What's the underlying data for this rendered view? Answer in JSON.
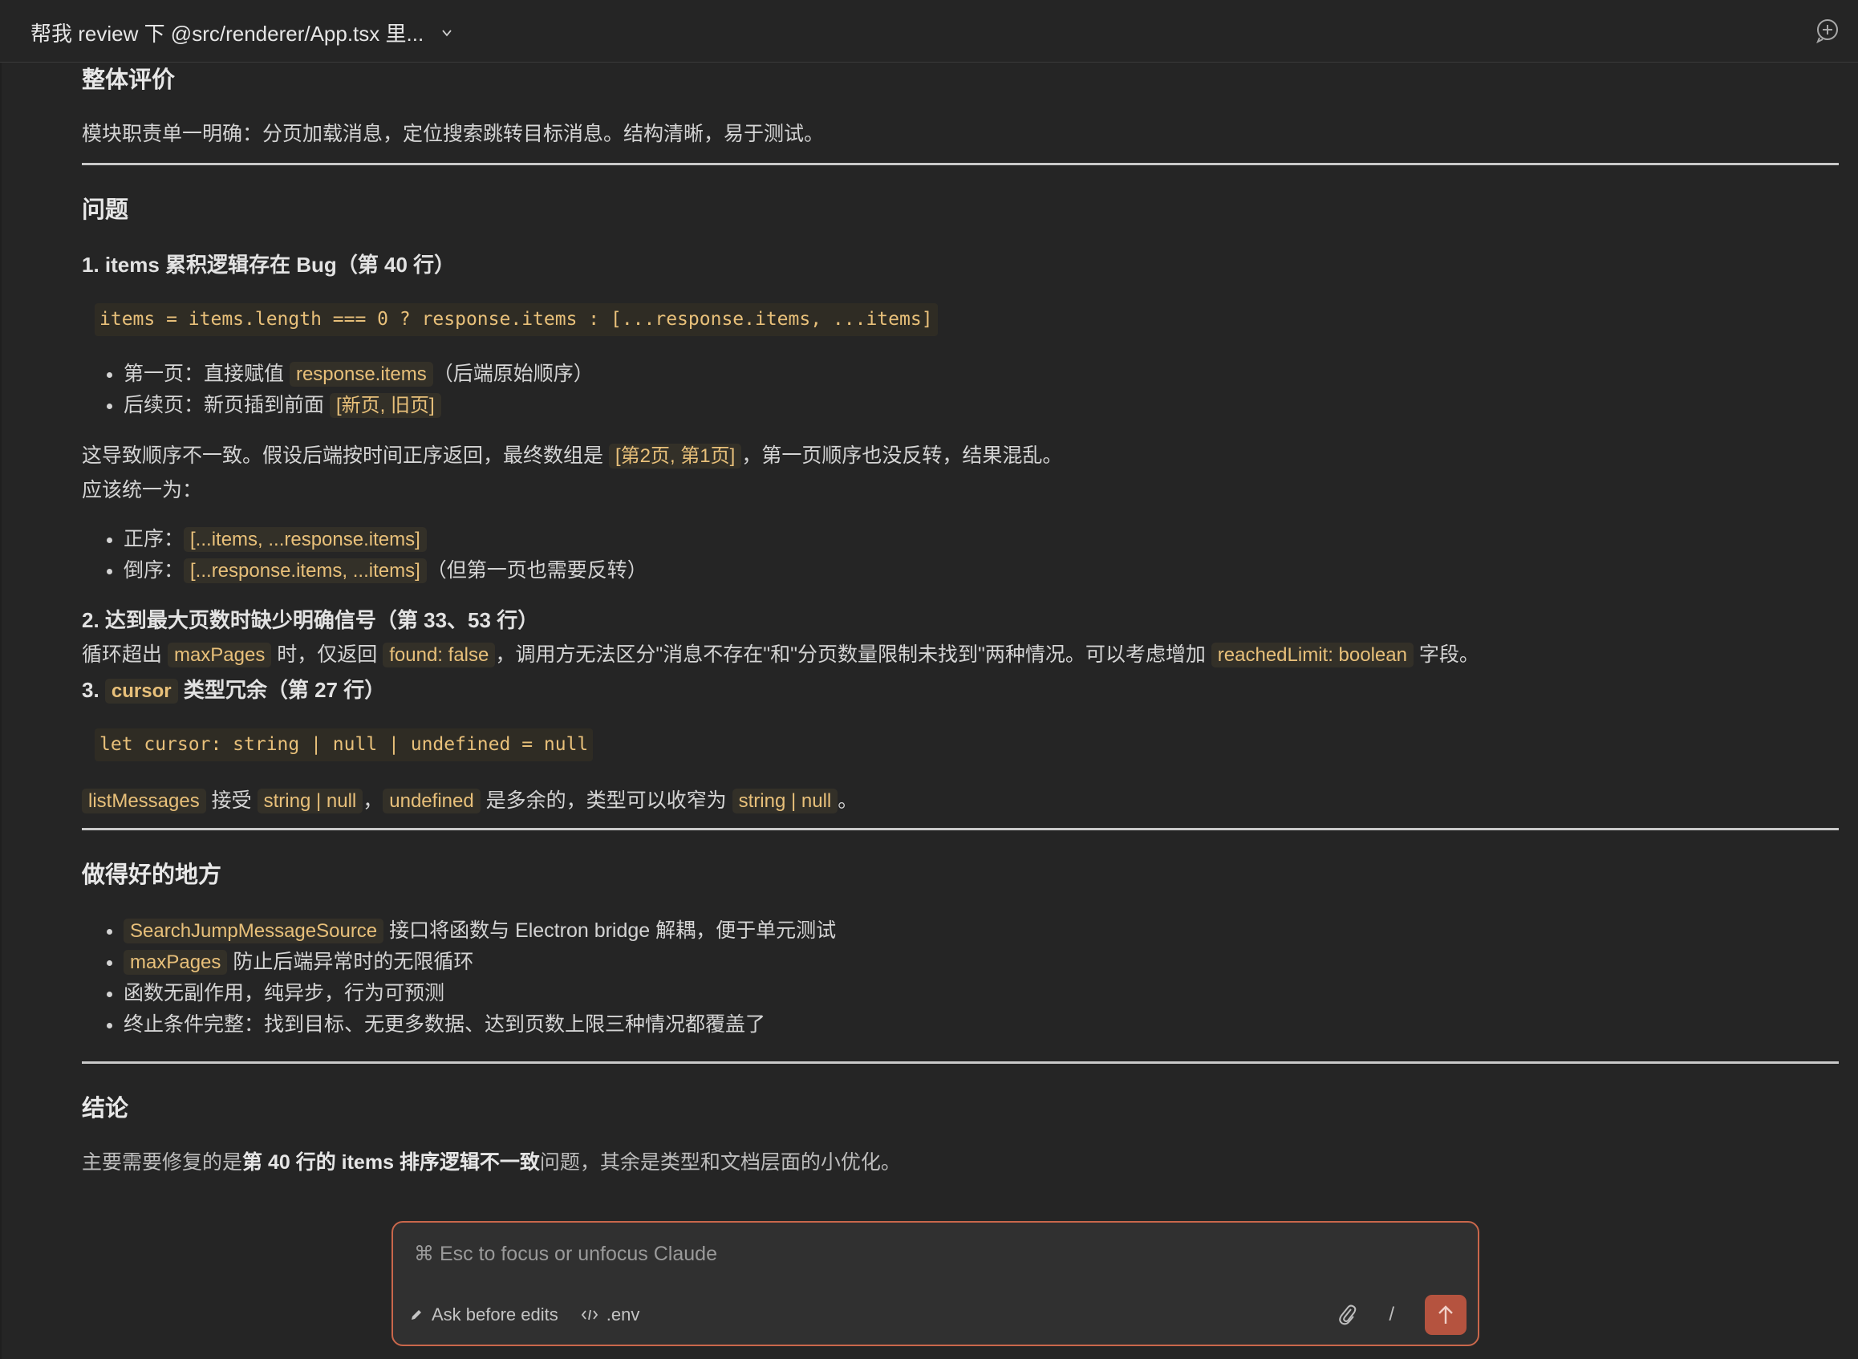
{
  "header": {
    "title": "帮我 review 下 @src/renderer/App.tsx 里..."
  },
  "review": {
    "overall": {
      "heading": "整体评价",
      "text": "模块职责单一明确：分页加载消息，定位搜索跳转目标消息。结构清晰，易于测试。"
    },
    "issues": {
      "heading": "问题",
      "issue1": {
        "title": "1. items 累积逻辑存在 Bug（第 40 行）",
        "code": "items = items.length === 0 ? response.items : [...response.items, ...items]",
        "bullets": [
          {
            "prefix": "第一页：直接赋值 ",
            "code": "response.items",
            "suffix": "（后端原始顺序）"
          },
          {
            "prefix": "后续页：新页插到前面 ",
            "code": "[新页, 旧页]",
            "suffix": ""
          }
        ],
        "para_prefix": "这导致顺序不一致。假设后端按时间正序返回，最终数组是 ",
        "para_code": "[第2页, 第1页]",
        "para_suffix": "，第一页顺序也没反转，结果混乱。",
        "para2": "应该统一为：",
        "fix_bullets": [
          {
            "prefix": "正序：",
            "code": "[...items, ...response.items]",
            "suffix": ""
          },
          {
            "prefix": "倒序：",
            "code": "[...response.items, ...items]",
            "suffix": "（但第一页也需要反转）"
          }
        ]
      },
      "issue2": {
        "title": "2. 达到最大页数时缺少明确信号（第 33、53 行）",
        "t1": "循环超出 ",
        "c1": "maxPages",
        "t2": " 时，仅返回 ",
        "c2": "found: false",
        "t3": "，调用方无法区分\"消息不存在\"和\"分页数量限制未找到\"两种情况。可以考虑增加 ",
        "c3": "reachedLimit: boolean",
        "t4": " 字段。"
      },
      "issue3": {
        "title_prefix": "3. ",
        "title_code": "cursor",
        "title_suffix": " 类型冗余（第 27 行）",
        "code": "let cursor: string | null | undefined = null",
        "c1": "listMessages",
        "t1": " 接受 ",
        "c2": "string | null",
        "t2": "，",
        "c3": "undefined",
        "t3": " 是多余的，类型可以收窄为 ",
        "c4": "string | null",
        "t4": "。"
      }
    },
    "good": {
      "heading": "做得好的地方",
      "bullets": [
        {
          "code": "SearchJumpMessageSource",
          "text": " 接口将函数与 Electron bridge 解耦，便于单元测试"
        },
        {
          "code": "maxPages",
          "text": " 防止后端异常时的无限循环"
        },
        {
          "code": "",
          "text": "函数无副作用，纯异步，行为可预测"
        },
        {
          "code": "",
          "text": "终止条件完整：找到目标、无更多数据、达到页数上限三种情况都覆盖了"
        }
      ]
    },
    "conclusion": {
      "heading": "结论",
      "t1": "主要需要修复的是",
      "strong": "第 40 行的 items 排序逻辑不一致",
      "t2": "问题，其余是类型和文档层面的小优化。"
    }
  },
  "composer": {
    "placeholder": "⌘ Esc to focus or unfocus Claude",
    "mode_label": "Ask before edits",
    "file_label": ".env",
    "slash": "/"
  },
  "colors": {
    "background": "#252525",
    "code_text": "#e8c07a",
    "accent": "#c9674b"
  }
}
